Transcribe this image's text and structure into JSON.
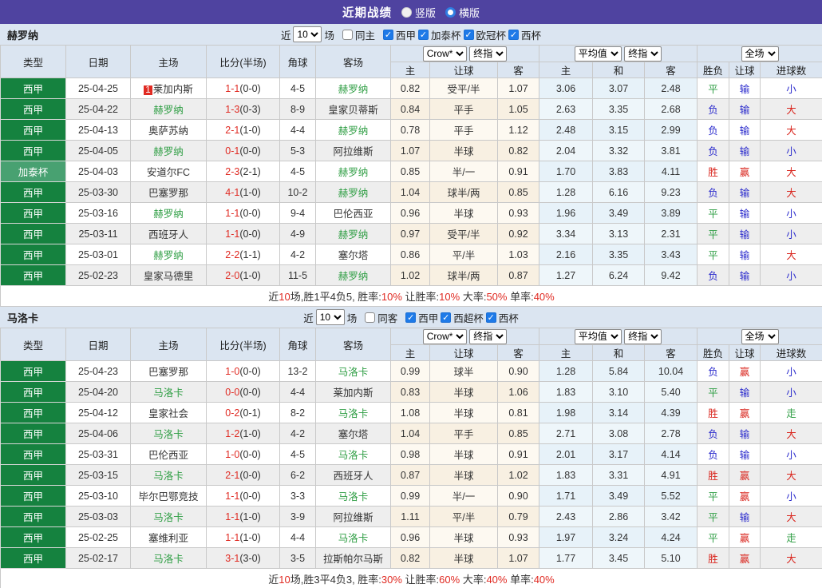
{
  "topbar": {
    "title": "近期战绩",
    "radio_vertical": "竖版",
    "radio_horizontal": "横版",
    "selected": "横版"
  },
  "colors": {
    "topbar_purple": "#4f43a0",
    "header_bg": "#dbe5f1",
    "type_green": "#15823f",
    "type_green_alt": "#48a171",
    "team_green": "#2f9e44",
    "score_red": "#e02a22",
    "win_red": "#d9251d",
    "lose_blue": "#2929cc",
    "draw_green": "#2f9e44",
    "checkbox_blue": "#1e7ae8"
  },
  "result_color_map": {
    "胜": "r",
    "赢": "r",
    "大": "r",
    "负": "b",
    "输": "b",
    "小": "b",
    "平": "g",
    "走": "g"
  },
  "header": {
    "columns_left": [
      "类型",
      "日期",
      "主场",
      "比分(半场)",
      "角球",
      "客场"
    ],
    "sub_columns": [
      "主",
      "让球",
      "客",
      "主",
      "和",
      "客",
      "胜负",
      "让球",
      "进球数"
    ],
    "select_groups": [
      [
        "Crow*",
        "终指"
      ],
      [
        "平均值",
        "终指"
      ],
      [
        "全场"
      ]
    ]
  },
  "sections": [
    {
      "team": "赫罗纳",
      "filter": {
        "near": "近",
        "count": "10",
        "games": "场",
        "same": "同主",
        "same_checked": false,
        "leagues": [
          "西甲",
          "加泰杯",
          "欧冠杯",
          "西杯"
        ],
        "check_icon": "✓"
      },
      "rows": [
        {
          "type": "西甲",
          "type_alt": false,
          "date": "25-04-25",
          "home": "莱加内斯",
          "home_hl": false,
          "home_badge": "1",
          "score": "1-1",
          "half": "(0-0)",
          "corner": "4-5",
          "away": "赫罗纳",
          "away_hl": true,
          "odds": [
            "0.82",
            "受平/半",
            "1.07"
          ],
          "avg": [
            "3.06",
            "3.07",
            "2.48"
          ],
          "results": [
            "平",
            "输",
            "小"
          ]
        },
        {
          "type": "西甲",
          "type_alt": false,
          "date": "25-04-22",
          "home": "赫罗纳",
          "home_hl": true,
          "home_badge": "",
          "score": "1-3",
          "half": "(0-3)",
          "corner": "8-9",
          "away": "皇家贝蒂斯",
          "away_hl": false,
          "odds": [
            "0.84",
            "平手",
            "1.05"
          ],
          "avg": [
            "2.63",
            "3.35",
            "2.68"
          ],
          "results": [
            "负",
            "输",
            "大"
          ]
        },
        {
          "type": "西甲",
          "type_alt": false,
          "date": "25-04-13",
          "home": "奥萨苏纳",
          "home_hl": false,
          "home_badge": "",
          "score": "2-1",
          "half": "(1-0)",
          "corner": "4-4",
          "away": "赫罗纳",
          "away_hl": true,
          "odds": [
            "0.78",
            "平手",
            "1.12"
          ],
          "avg": [
            "2.48",
            "3.15",
            "2.99"
          ],
          "results": [
            "负",
            "输",
            "大"
          ]
        },
        {
          "type": "西甲",
          "type_alt": false,
          "date": "25-04-05",
          "home": "赫罗纳",
          "home_hl": true,
          "home_badge": "",
          "score": "0-1",
          "half": "(0-0)",
          "corner": "5-3",
          "away": "阿拉维斯",
          "away_hl": false,
          "odds": [
            "1.07",
            "半球",
            "0.82"
          ],
          "avg": [
            "2.04",
            "3.32",
            "3.81"
          ],
          "results": [
            "负",
            "输",
            "小"
          ]
        },
        {
          "type": "加泰杯",
          "type_alt": true,
          "date": "25-04-03",
          "home": "安道尔FC",
          "home_hl": false,
          "home_badge": "",
          "score": "2-3",
          "half": "(2-1)",
          "corner": "4-5",
          "away": "赫罗纳",
          "away_hl": true,
          "odds": [
            "0.85",
            "半/一",
            "0.91"
          ],
          "avg": [
            "1.70",
            "3.83",
            "4.11"
          ],
          "results": [
            "胜",
            "赢",
            "大"
          ]
        },
        {
          "type": "西甲",
          "type_alt": false,
          "date": "25-03-30",
          "home": "巴塞罗那",
          "home_hl": false,
          "home_badge": "",
          "score": "4-1",
          "half": "(1-0)",
          "corner": "10-2",
          "away": "赫罗纳",
          "away_hl": true,
          "odds": [
            "1.04",
            "球半/两",
            "0.85"
          ],
          "avg": [
            "1.28",
            "6.16",
            "9.23"
          ],
          "results": [
            "负",
            "输",
            "大"
          ]
        },
        {
          "type": "西甲",
          "type_alt": false,
          "date": "25-03-16",
          "home": "赫罗纳",
          "home_hl": true,
          "home_badge": "",
          "score": "1-1",
          "half": "(0-0)",
          "corner": "9-4",
          "away": "巴伦西亚",
          "away_hl": false,
          "odds": [
            "0.96",
            "半球",
            "0.93"
          ],
          "avg": [
            "1.96",
            "3.49",
            "3.89"
          ],
          "results": [
            "平",
            "输",
            "小"
          ]
        },
        {
          "type": "西甲",
          "type_alt": false,
          "date": "25-03-11",
          "home": "西班牙人",
          "home_hl": false,
          "home_badge": "",
          "score": "1-1",
          "half": "(0-0)",
          "corner": "4-9",
          "away": "赫罗纳",
          "away_hl": true,
          "odds": [
            "0.97",
            "受平/半",
            "0.92"
          ],
          "avg": [
            "3.34",
            "3.13",
            "2.31"
          ],
          "results": [
            "平",
            "输",
            "小"
          ]
        },
        {
          "type": "西甲",
          "type_alt": false,
          "date": "25-03-01",
          "home": "赫罗纳",
          "home_hl": true,
          "home_badge": "",
          "score": "2-2",
          "half": "(1-1)",
          "corner": "4-2",
          "away": "塞尔塔",
          "away_hl": false,
          "odds": [
            "0.86",
            "平/半",
            "1.03"
          ],
          "avg": [
            "2.16",
            "3.35",
            "3.43"
          ],
          "results": [
            "平",
            "输",
            "大"
          ]
        },
        {
          "type": "西甲",
          "type_alt": false,
          "date": "25-02-23",
          "home": "皇家马德里",
          "home_hl": false,
          "home_badge": "",
          "score": "2-0",
          "half": "(1-0)",
          "corner": "11-5",
          "away": "赫罗纳",
          "away_hl": true,
          "odds": [
            "1.02",
            "球半/两",
            "0.87"
          ],
          "avg": [
            "1.27",
            "6.24",
            "9.42"
          ],
          "results": [
            "负",
            "输",
            "小"
          ]
        }
      ],
      "summary": [
        {
          "t": "近",
          "red": false
        },
        {
          "t": "10",
          "red": true
        },
        {
          "t": "场,胜1平4负5, 胜率:",
          "red": false
        },
        {
          "t": "10%",
          "red": true
        },
        {
          "t": " 让胜率:",
          "red": false
        },
        {
          "t": "10%",
          "red": true
        },
        {
          "t": " 大率:",
          "red": false
        },
        {
          "t": "50%",
          "red": true
        },
        {
          "t": " 单率:",
          "red": false
        },
        {
          "t": "40%",
          "red": true
        }
      ]
    },
    {
      "team": "马洛卡",
      "filter": {
        "near": "近",
        "count": "10",
        "games": "场",
        "same": "同客",
        "same_checked": false,
        "leagues": [
          "西甲",
          "西超杯",
          "西杯"
        ],
        "check_icon": "✓"
      },
      "rows": [
        {
          "type": "西甲",
          "type_alt": false,
          "date": "25-04-23",
          "home": "巴塞罗那",
          "home_hl": false,
          "home_badge": "",
          "score": "1-0",
          "half": "(0-0)",
          "corner": "13-2",
          "away": "马洛卡",
          "away_hl": true,
          "odds": [
            "0.99",
            "球半",
            "0.90"
          ],
          "avg": [
            "1.28",
            "5.84",
            "10.04"
          ],
          "results": [
            "负",
            "赢",
            "小"
          ]
        },
        {
          "type": "西甲",
          "type_alt": false,
          "date": "25-04-20",
          "home": "马洛卡",
          "home_hl": true,
          "home_badge": "",
          "score": "0-0",
          "half": "(0-0)",
          "corner": "4-4",
          "away": "莱加内斯",
          "away_hl": false,
          "odds": [
            "0.83",
            "半球",
            "1.06"
          ],
          "avg": [
            "1.83",
            "3.10",
            "5.40"
          ],
          "results": [
            "平",
            "输",
            "小"
          ]
        },
        {
          "type": "西甲",
          "type_alt": false,
          "date": "25-04-12",
          "home": "皇家社会",
          "home_hl": false,
          "home_badge": "",
          "score": "0-2",
          "half": "(0-1)",
          "corner": "8-2",
          "away": "马洛卡",
          "away_hl": true,
          "odds": [
            "1.08",
            "半球",
            "0.81"
          ],
          "avg": [
            "1.98",
            "3.14",
            "4.39"
          ],
          "results": [
            "胜",
            "赢",
            "走"
          ]
        },
        {
          "type": "西甲",
          "type_alt": false,
          "date": "25-04-06",
          "home": "马洛卡",
          "home_hl": true,
          "home_badge": "",
          "score": "1-2",
          "half": "(1-0)",
          "corner": "4-2",
          "away": "塞尔塔",
          "away_hl": false,
          "odds": [
            "1.04",
            "平手",
            "0.85"
          ],
          "avg": [
            "2.71",
            "3.08",
            "2.78"
          ],
          "results": [
            "负",
            "输",
            "大"
          ]
        },
        {
          "type": "西甲",
          "type_alt": false,
          "date": "25-03-31",
          "home": "巴伦西亚",
          "home_hl": false,
          "home_badge": "",
          "score": "1-0",
          "half": "(0-0)",
          "corner": "4-5",
          "away": "马洛卡",
          "away_hl": true,
          "odds": [
            "0.98",
            "半球",
            "0.91"
          ],
          "avg": [
            "2.01",
            "3.17",
            "4.14"
          ],
          "results": [
            "负",
            "输",
            "小"
          ]
        },
        {
          "type": "西甲",
          "type_alt": false,
          "date": "25-03-15",
          "home": "马洛卡",
          "home_hl": true,
          "home_badge": "",
          "score": "2-1",
          "half": "(0-0)",
          "corner": "6-2",
          "away": "西班牙人",
          "away_hl": false,
          "odds": [
            "0.87",
            "半球",
            "1.02"
          ],
          "avg": [
            "1.83",
            "3.31",
            "4.91"
          ],
          "results": [
            "胜",
            "赢",
            "大"
          ]
        },
        {
          "type": "西甲",
          "type_alt": false,
          "date": "25-03-10",
          "home": "毕尔巴鄂竞技",
          "home_hl": false,
          "home_badge": "",
          "score": "1-1",
          "half": "(0-0)",
          "corner": "3-3",
          "away": "马洛卡",
          "away_hl": true,
          "odds": [
            "0.99",
            "半/一",
            "0.90"
          ],
          "avg": [
            "1.71",
            "3.49",
            "5.52"
          ],
          "results": [
            "平",
            "赢",
            "小"
          ]
        },
        {
          "type": "西甲",
          "type_alt": false,
          "date": "25-03-03",
          "home": "马洛卡",
          "home_hl": true,
          "home_badge": "",
          "score": "1-1",
          "half": "(1-0)",
          "corner": "3-9",
          "away": "阿拉维斯",
          "away_hl": false,
          "odds": [
            "1.11",
            "平/半",
            "0.79"
          ],
          "avg": [
            "2.43",
            "2.86",
            "3.42"
          ],
          "results": [
            "平",
            "输",
            "大"
          ]
        },
        {
          "type": "西甲",
          "type_alt": false,
          "date": "25-02-25",
          "home": "塞维利亚",
          "home_hl": false,
          "home_badge": "",
          "score": "1-1",
          "half": "(1-0)",
          "corner": "4-4",
          "away": "马洛卡",
          "away_hl": true,
          "odds": [
            "0.96",
            "半球",
            "0.93"
          ],
          "avg": [
            "1.97",
            "3.24",
            "4.24"
          ],
          "results": [
            "平",
            "赢",
            "走"
          ]
        },
        {
          "type": "西甲",
          "type_alt": false,
          "date": "25-02-17",
          "home": "马洛卡",
          "home_hl": true,
          "home_badge": "",
          "score": "3-1",
          "half": "(3-0)",
          "corner": "3-5",
          "away": "拉斯帕尔马斯",
          "away_hl": false,
          "odds": [
            "0.82",
            "半球",
            "1.07"
          ],
          "avg": [
            "1.77",
            "3.45",
            "5.10"
          ],
          "results": [
            "胜",
            "赢",
            "大"
          ]
        }
      ],
      "summary": [
        {
          "t": "近",
          "red": false
        },
        {
          "t": "10",
          "red": true
        },
        {
          "t": "场,胜3平4负3, 胜率:",
          "red": false
        },
        {
          "t": "30%",
          "red": true
        },
        {
          "t": " 让胜率:",
          "red": false
        },
        {
          "t": "60%",
          "red": true
        },
        {
          "t": " 大率:",
          "red": false
        },
        {
          "t": "40%",
          "red": true
        },
        {
          "t": " 单率:",
          "red": false
        },
        {
          "t": "40%",
          "red": true
        }
      ]
    }
  ]
}
